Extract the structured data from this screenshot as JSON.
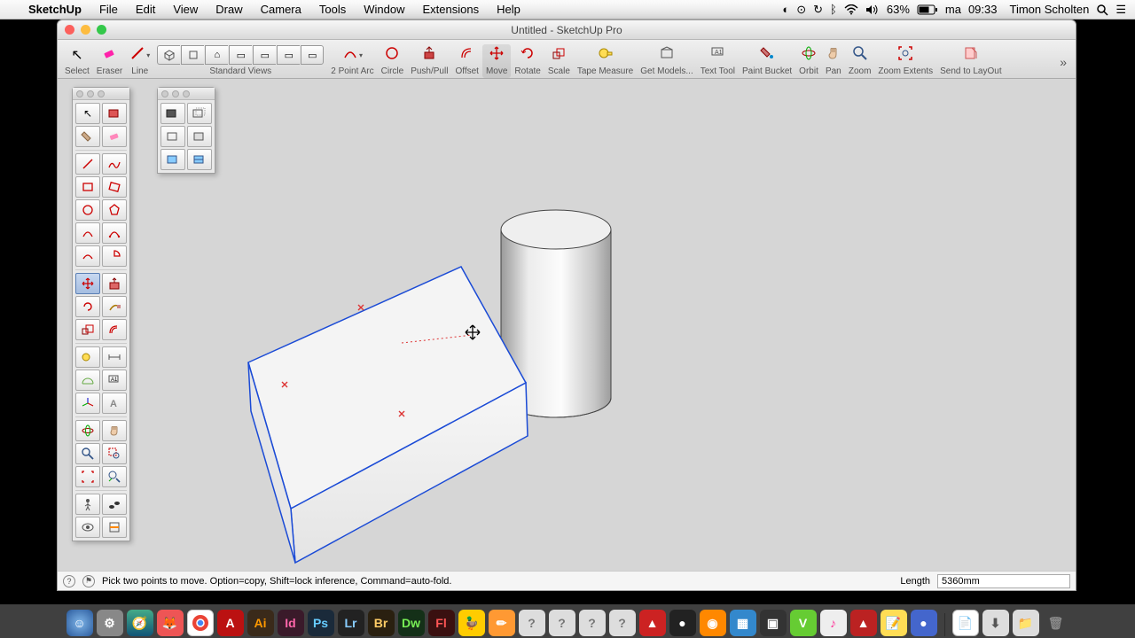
{
  "menubar": {
    "app": "SketchUp",
    "items": [
      "File",
      "Edit",
      "View",
      "Draw",
      "Camera",
      "Tools",
      "Window",
      "Extensions",
      "Help"
    ],
    "battery": "63%",
    "day": "ma",
    "time": "09:33",
    "user": "Timon Scholten"
  },
  "window": {
    "title": "Untitled - SketchUp Pro"
  },
  "toolbar": {
    "select": "Select",
    "eraser": "Eraser",
    "line": "Line",
    "views": "Standard Views",
    "arc": "2 Point Arc",
    "circle": "Circle",
    "pushpull": "Push/Pull",
    "offset": "Offset",
    "move": "Move",
    "rotate": "Rotate",
    "scale": "Scale",
    "tape": "Tape Measure",
    "getmodels": "Get Models...",
    "texttool": "Text Tool",
    "paint": "Paint Bucket",
    "orbit": "Orbit",
    "pan": "Pan",
    "zoom": "Zoom",
    "zoomext": "Zoom Extents",
    "layout": "Send to LayOut"
  },
  "status": {
    "hint": "Pick two points to move.  Option=copy, Shift=lock inference, Command=auto-fold.",
    "length_label": "Length",
    "length_value": "5360mm"
  }
}
